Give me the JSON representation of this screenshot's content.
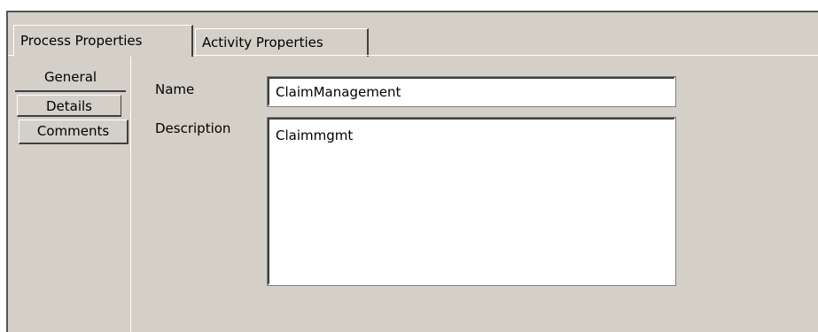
{
  "tabs": {
    "process_properties": "Process Properties",
    "activity_properties": "Activity Properties"
  },
  "side_tabs": {
    "general": "General",
    "details": "Details",
    "comments": "Comments"
  },
  "form": {
    "name_label": "Name",
    "name_value": "ClaimManagement",
    "description_label": "Description",
    "description_value": "Claimmgmt"
  },
  "colors": {
    "panel_background": "#d4d0c8",
    "input_background": "#ffffff"
  }
}
